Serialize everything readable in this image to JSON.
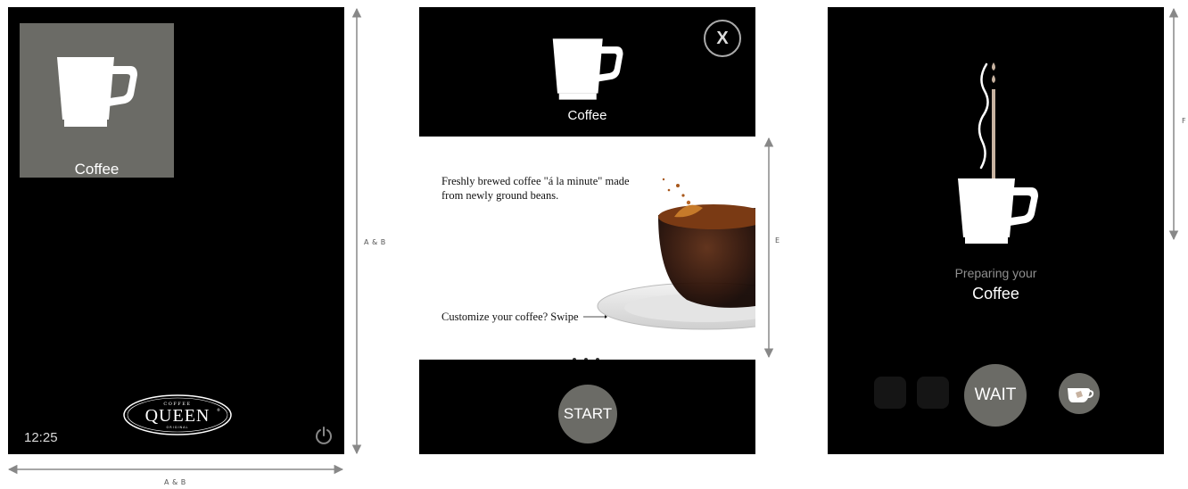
{
  "home": {
    "tile_label": "Coffee",
    "clock": "12:25",
    "logo": {
      "top": "COFFEE",
      "main": "QUEEN",
      "bottom": "ORIGINAL",
      "mark": "®"
    }
  },
  "detail": {
    "close_label": "X",
    "title": "Coffee",
    "description": "Freshly brewed coffee \"á la minute\" made from newly ground beans.",
    "swipe_hint": "Customize your coffee? Swipe",
    "page_dots": 3,
    "start_label": "START"
  },
  "brewing": {
    "status": "Preparing your",
    "title": "Coffee",
    "wait_label": "WAIT"
  },
  "dimensions": {
    "tile_width": "C",
    "tile_height": "C",
    "logo_width": "D",
    "logo_height": "D",
    "screen_width": "A & B",
    "screen_height": "A & B",
    "panel_width": "E",
    "panel_height": "E",
    "anim_height": "F"
  },
  "colors": {
    "tile": "#6b6b66",
    "screen_bg": "#000000",
    "accent_light": "#c7b2a0"
  }
}
